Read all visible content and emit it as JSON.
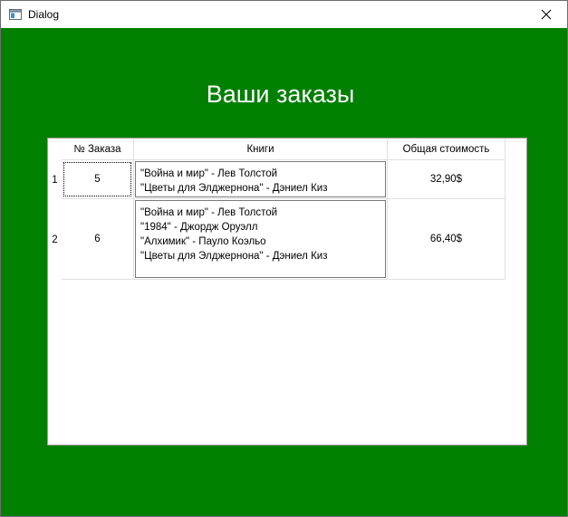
{
  "window": {
    "title": "Dialog"
  },
  "heading": "Ваши заказы",
  "table": {
    "columns": [
      "№ Заказа",
      "Книги",
      "Общая стоимость"
    ],
    "rows": [
      {
        "row_number": "1",
        "order_number": "5",
        "books": [
          "\"Война и мир\" - Лев Толстой",
          "\"Цветы для Элджернона\" - Дэниел Киз"
        ],
        "total_cost": "32,90$"
      },
      {
        "row_number": "2",
        "order_number": "6",
        "books": [
          "\"Война и мир\" - Лев Толстой",
          "\"1984\" - Джордж Оруэлл",
          "\"Алхимик\" - Пауло Коэльо",
          "\"Цветы для Элджернона\" - Дэниел Киз"
        ],
        "total_cost": "66,40$"
      }
    ]
  },
  "colors": {
    "background": "#007f00",
    "heading_text": "#ffffff"
  }
}
